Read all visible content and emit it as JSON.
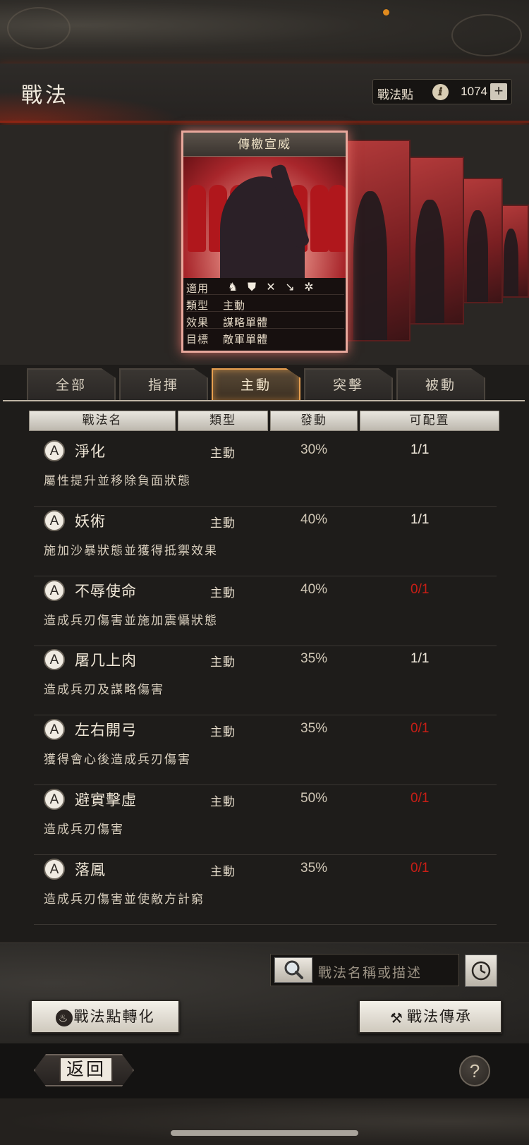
{
  "header": {
    "title": "戰法",
    "points_label": "戰法點",
    "points_value": "1074",
    "plus_label": "+"
  },
  "card": {
    "title": "傳檄宣威",
    "rows": [
      {
        "key": "適用",
        "value": ""
      },
      {
        "key": "類型",
        "value": "主動"
      },
      {
        "key": "效果",
        "value": "謀略單體"
      },
      {
        "key": "目標",
        "value": "敵軍單體"
      }
    ],
    "applicable_icons": [
      "cavalry-icon",
      "shield-icon",
      "bow-icon",
      "spear-icon",
      "wheel-icon"
    ]
  },
  "tabs": [
    {
      "label": "全部",
      "active": false
    },
    {
      "label": "指揮",
      "active": false
    },
    {
      "label": "主動",
      "active": true
    },
    {
      "label": "突擊",
      "active": false
    },
    {
      "label": "被動",
      "active": false
    }
  ],
  "columns": [
    "戰法名",
    "類型",
    "發動",
    "可配置"
  ],
  "rows": [
    {
      "badge": "A",
      "name": "淨化",
      "type": "主動",
      "rate": "30%",
      "avail": "1/1",
      "avail_red": false,
      "desc": "屬性提升並移除負面狀態"
    },
    {
      "badge": "A",
      "name": "妖術",
      "type": "主動",
      "rate": "40%",
      "avail": "1/1",
      "avail_red": false,
      "desc": "施加沙暴狀態並獲得抵禦效果"
    },
    {
      "badge": "A",
      "name": "不辱使命",
      "type": "主動",
      "rate": "40%",
      "avail": "0/1",
      "avail_red": true,
      "desc": "造成兵刃傷害並施加震懾狀態"
    },
    {
      "badge": "A",
      "name": "屠几上肉",
      "type": "主動",
      "rate": "35%",
      "avail": "1/1",
      "avail_red": false,
      "desc": "造成兵刃及謀略傷害"
    },
    {
      "badge": "A",
      "name": "左右開弓",
      "type": "主動",
      "rate": "35%",
      "avail": "0/1",
      "avail_red": true,
      "desc": "獲得會心後造成兵刃傷害"
    },
    {
      "badge": "A",
      "name": "避實擊虛",
      "type": "主動",
      "rate": "50%",
      "avail": "0/1",
      "avail_red": true,
      "desc": "造成兵刃傷害"
    },
    {
      "badge": "A",
      "name": "落鳳",
      "type": "主動",
      "rate": "35%",
      "avail": "0/1",
      "avail_red": true,
      "desc": "造成兵刃傷害並使敵方計窮"
    }
  ],
  "search": {
    "placeholder": "戰法名稱或描述"
  },
  "buttons": {
    "convert": "戰法點轉化",
    "inherit": "戰法傳承",
    "back": "返回",
    "help": "?"
  },
  "colors": {
    "accent": "#e8a050",
    "red_value": "#c81e16",
    "card_glow": "#e8a89c"
  }
}
